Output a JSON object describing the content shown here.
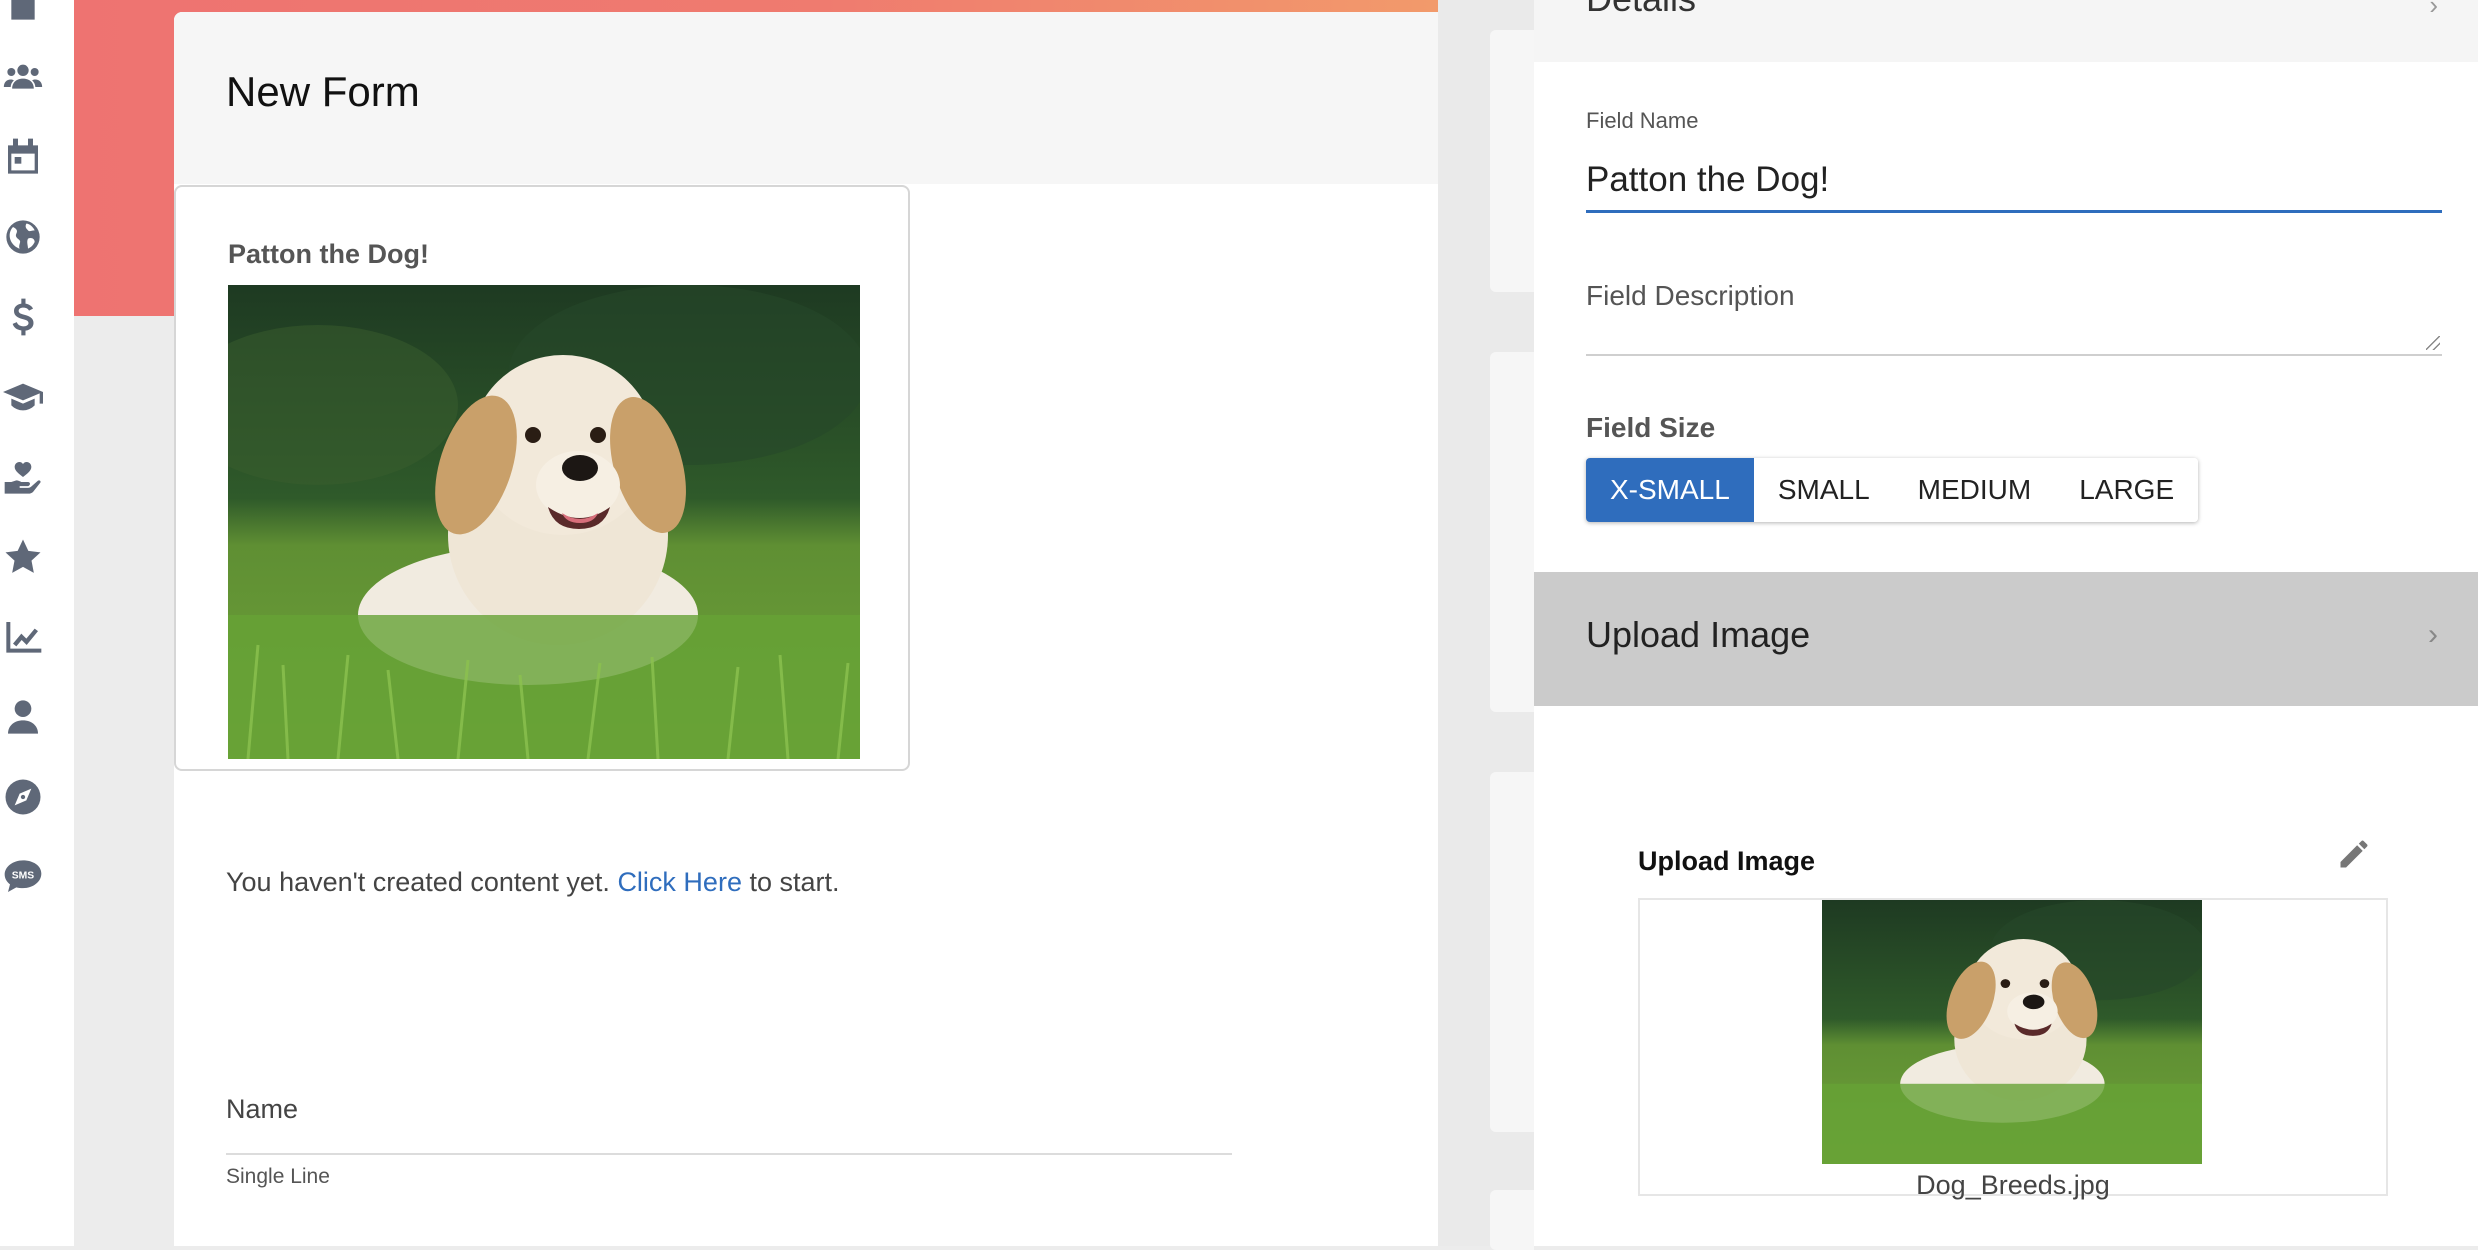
{
  "sidebar": {
    "icons": [
      "document-icon",
      "users-icon",
      "calendar-icon",
      "globe-icon",
      "dollar-icon",
      "graduation-cap-icon",
      "donate-hand-heart-icon",
      "star-icon",
      "chart-line-icon",
      "user-icon",
      "compass-icon",
      "sms-icon"
    ]
  },
  "form": {
    "title": "New Form",
    "image_field": {
      "caption": "Patton the Dog!"
    },
    "empty_message": {
      "prefix": "You haven't created content yet. ",
      "link": "Click Here",
      "suffix": " to start."
    },
    "name_field": {
      "label": "Name",
      "type_label": "Single Line"
    }
  },
  "panel": {
    "details_label": "Details",
    "field_name_label": "Field Name",
    "field_name_value": "Patton the Dog!",
    "field_description_label": "Field Description",
    "field_size_label": "Field Size",
    "sizes": [
      "X-SMALL",
      "SMALL",
      "MEDIUM",
      "LARGE"
    ],
    "selected_size": "X-SMALL",
    "upload_section_label": "Upload Image",
    "upload": {
      "title": "Upload Image",
      "filename": "Dog_Breeds.jpg"
    }
  },
  "colors": {
    "accent": "#2f6dbd",
    "header_band": "#ee7371",
    "icon": "#5f6878"
  }
}
